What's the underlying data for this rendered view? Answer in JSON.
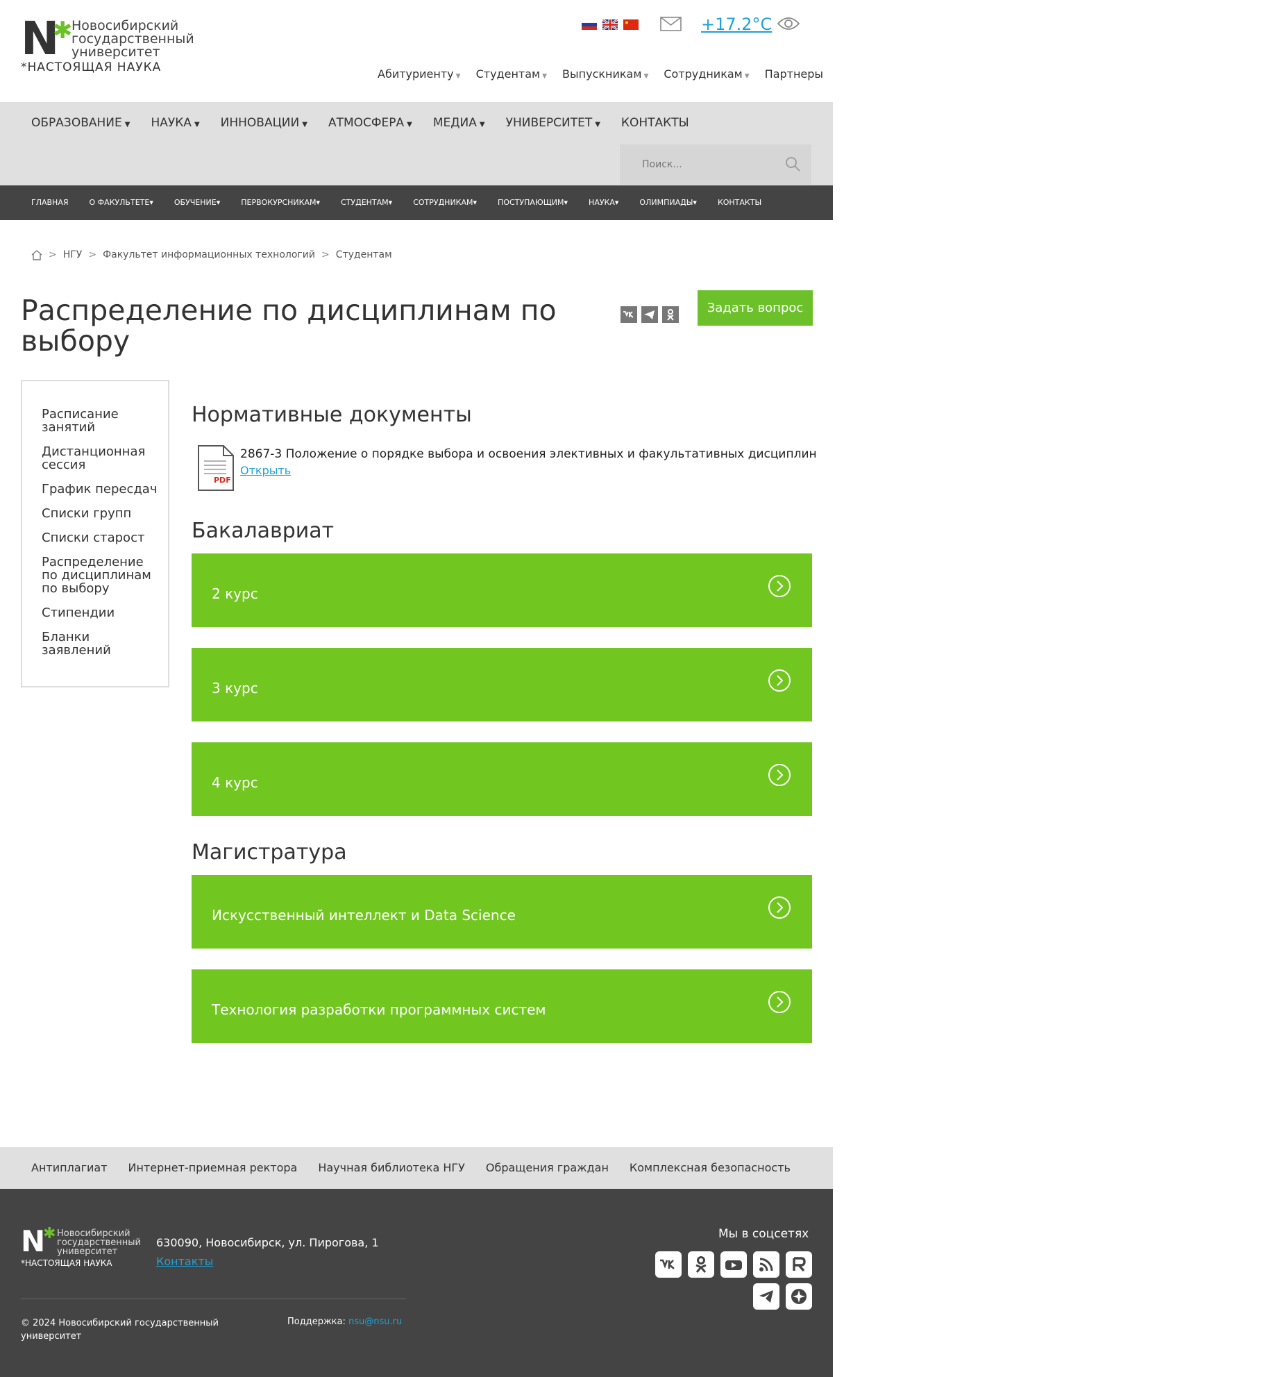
{
  "header": {
    "logo_letter": "N",
    "logo_star": "✱",
    "logo_line1": "Новосибирский",
    "logo_line2": "государственный",
    "logo_line3": "университет",
    "slogan": "*НАСТОЯЩАЯ НАУКА",
    "temperature": "+17.2°C",
    "top_nav": [
      {
        "label": "Абитуриенту",
        "dropdown": true
      },
      {
        "label": "Студентам",
        "dropdown": true
      },
      {
        "label": "Выпускникам",
        "dropdown": true
      },
      {
        "label": "Сотрудникам",
        "dropdown": true
      },
      {
        "label": "Партнеры",
        "dropdown": false
      }
    ]
  },
  "main_nav": [
    {
      "label": "ОБРАЗОВАНИЕ",
      "dropdown": true
    },
    {
      "label": "НАУКА",
      "dropdown": true
    },
    {
      "label": "ИННОВАЦИИ",
      "dropdown": true
    },
    {
      "label": "АТМОСФЕРА",
      "dropdown": true
    },
    {
      "label": "МЕДИА",
      "dropdown": true
    },
    {
      "label": "УНИВЕРСИТЕТ",
      "dropdown": true
    },
    {
      "label": "КОНТАКТЫ",
      "dropdown": false
    }
  ],
  "search": {
    "placeholder": "Поиск..."
  },
  "sub_nav": [
    {
      "label": "ГЛАВНАЯ",
      "dropdown": false
    },
    {
      "label": "О ФАКУЛЬТЕТЕ",
      "dropdown": true
    },
    {
      "label": "ОБУЧЕНИЕ",
      "dropdown": true
    },
    {
      "label": "ПЕРВОКУРСНИКАМ",
      "dropdown": true
    },
    {
      "label": "СТУДЕНТАМ",
      "dropdown": true
    },
    {
      "label": "СОТРУДНИКАМ",
      "dropdown": true
    },
    {
      "label": "ПОСТУПАЮЩИМ",
      "dropdown": true
    },
    {
      "label": "НАУКА",
      "dropdown": true
    },
    {
      "label": "ОЛИМПИАДЫ",
      "dropdown": true
    },
    {
      "label": "КОНТАКТЫ",
      "dropdown": false
    }
  ],
  "breadcrumbs": {
    "sep": ">",
    "items": [
      "НГУ",
      "Факультет информационных технологий"
    ],
    "current": "Студентам"
  },
  "page": {
    "title": "Распределение по дисциплинам по выбору",
    "ask_button": "Задать вопрос"
  },
  "side_menu": [
    "Расписание занятий",
    "Дистанционная сессия",
    "График пересдач",
    "Списки групп",
    "Списки старост",
    "Распределение по дисциплинам по выбору",
    "Стипендии",
    "Бланки заявлений"
  ],
  "docs": {
    "heading": "Нормативные документы",
    "file_badge": "PDF",
    "title": "2867-3 Положение о порядке выбора и освоения элективных и факультативных дисциплин",
    "link": "Открыть"
  },
  "bachelor": {
    "heading": "Бакалавриат",
    "items": [
      "2 курс",
      "3 курс",
      "4 курс"
    ]
  },
  "master": {
    "heading": "Магистратура",
    "items": [
      "Искусственный интеллект и Data Science",
      "Технология разработки программных систем"
    ]
  },
  "footer": {
    "links": [
      "Антиплагиат",
      "Интернет-приемная ректора",
      "Научная библиотека НГУ",
      "Обращения граждан",
      "Комплексная безопасность"
    ],
    "address": "630090, Новосибирск, ул. Пирогова, 1",
    "contacts": "Контакты",
    "copyright": "© 2024 Новосибирский государственный университет",
    "support_label": "Поддержка:",
    "support_email": "nsu@nsu.ru",
    "social_title": "Мы в соцсетях",
    "social": [
      "vk-icon",
      "ok-icon",
      "youtube-icon",
      "rss-icon",
      "rutube-icon",
      "telegram-icon",
      "plus-icon"
    ]
  },
  "colors": {
    "accent": "#72c620",
    "link": "#1ea2d8",
    "dark": "#444444",
    "grey": "#e0e0e0"
  }
}
